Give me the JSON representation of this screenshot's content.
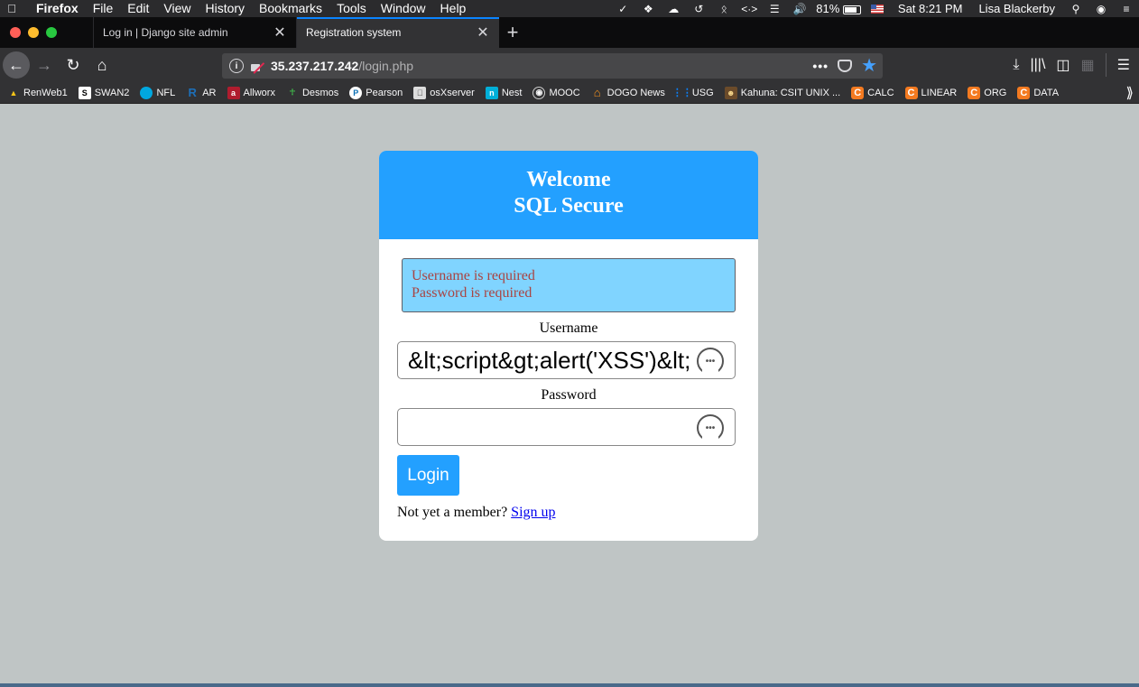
{
  "menubar": {
    "apple_icon": "apple-logo-icon",
    "app": "Firefox",
    "menus": [
      "File",
      "Edit",
      "View",
      "History",
      "Bookmarks",
      "Tools",
      "Window",
      "Help"
    ],
    "battery": "81%",
    "battery_level": 0.81,
    "clock": "Sat 8:21 PM",
    "user": "Lisa Blackerby"
  },
  "tabs": [
    {
      "label": "Log in | Django site admin",
      "active": false
    },
    {
      "label": "Registration system",
      "active": true
    }
  ],
  "navbar": {
    "url_host": "35.237.217.242",
    "url_path": "/login.php",
    "page_actions": "•••"
  },
  "bookmarks": [
    {
      "label": "RenWeb1",
      "icon": "renweb-icon"
    },
    {
      "label": "SWAN2",
      "icon": "swan-icon"
    },
    {
      "label": "NFL",
      "icon": "att-icon"
    },
    {
      "label": "AR",
      "icon": "ar-icon"
    },
    {
      "label": "Allworx",
      "icon": "allworx-icon"
    },
    {
      "label": "Desmos",
      "icon": "desmos-icon"
    },
    {
      "label": "Pearson",
      "icon": "pearson-icon"
    },
    {
      "label": "osXserver",
      "icon": "apple-icon"
    },
    {
      "label": "Nest",
      "icon": "nest-icon"
    },
    {
      "label": "MOOC",
      "icon": "globe-icon"
    },
    {
      "label": "DOGO News",
      "icon": "home-icon"
    },
    {
      "label": "USG",
      "icon": "dots-icon"
    },
    {
      "label": "Kahuna: CSIT UNIX ...",
      "icon": "kahuna-icon"
    },
    {
      "label": "CALC",
      "icon": "c-icon"
    },
    {
      "label": "LINEAR",
      "icon": "c-icon"
    },
    {
      "label": "ORG",
      "icon": "c-icon"
    },
    {
      "label": "DATA",
      "icon": "c-icon"
    }
  ],
  "page": {
    "header_line1": "Welcome",
    "header_line2": "SQL Secure",
    "errors": [
      "Username is required",
      "Password is required"
    ],
    "username_label": "Username",
    "username_value": "&lt;script&gt;alert('XSS')&lt;/script&gt;",
    "password_label": "Password",
    "password_value": "",
    "login_button": "Login",
    "signup_text": "Not yet a member?",
    "signup_link": "Sign up"
  },
  "colors": {
    "accent": "#23a0ff",
    "error_bg": "#80d4ff",
    "error_text": "#a94442",
    "page_bg": "#bfc5c5"
  }
}
